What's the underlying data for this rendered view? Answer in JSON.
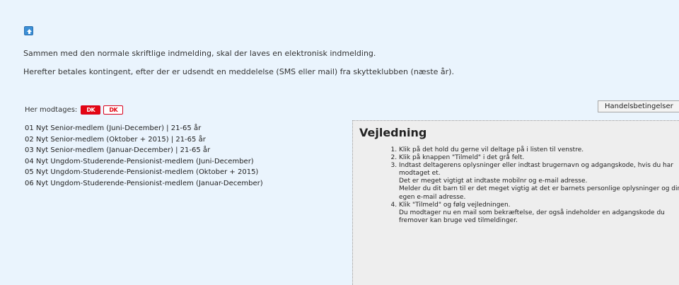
{
  "intro": {
    "line1": "Sammen med den normale skriftlige indmelding, skal der laves en elektronisk indmelding.",
    "line2": "Herefter betales kontingent, efter der er udsendt en meddelelse (SMS eller mail) fra skytteklubben (næste år)."
  },
  "payment": {
    "label": "Her modtages:",
    "cards": [
      "DK",
      "DK"
    ]
  },
  "terms_button": "Handelsbetingelser",
  "teams": [
    "01 Nyt Senior-medlem (Juni-December) | 21-65 år",
    "02 Nyt Senior-medlem (Oktober + 2015) | 21-65 år",
    "03 Nyt Senior-medlem (Januar-December) | 21-65 år",
    "04 Nyt Ungdom-Studerende-Pensionist-medlem (Juni-December)",
    "05 Nyt Ungdom-Studerende-Pensionist-medlem (Oktober + 2015)",
    "06 Nyt Ungdom-Studerende-Pensionist-medlem (Januar-December)"
  ],
  "guide": {
    "title": "Vejledning",
    "steps": [
      {
        "main": "Klik på det hold du gerne vil deltage på i listen til venstre.",
        "sub": []
      },
      {
        "main": "Klik på knappen \"Tilmeld\" i det grå felt.",
        "sub": []
      },
      {
        "main": "Indtast deltagerens oplysninger eller indtast brugernavn og adgangskode, hvis du har modtaget et.",
        "sub": [
          "Det er meget vigtigt at indtaste mobilnr og e-mail adresse.",
          "Melder du dit barn til er det meget vigtig at det er barnets personlige oplysninger og din egen e-mail adresse."
        ]
      },
      {
        "main": "Klik \"Tilmeld\" og følg vejledningen.",
        "sub": [
          "Du modtager nu en mail som bekræftelse, der også indeholder en adgangskode du fremover kan bruge ved tilmeldinger."
        ]
      }
    ]
  },
  "icons": {
    "up": "arrow-up-icon"
  },
  "colors": {
    "background": "#eaf4fd",
    "guide_bg": "#eeeeee",
    "card_red": "#e30613",
    "icon_blue": "#3c8fd6"
  }
}
